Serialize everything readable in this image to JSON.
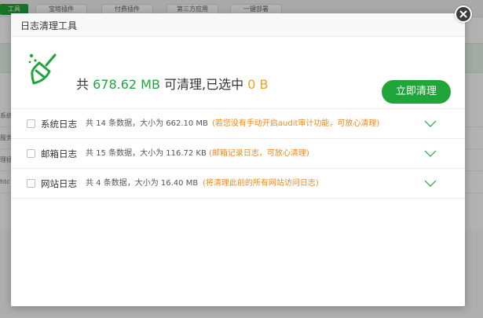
{
  "background": {
    "tabs": [
      "工具",
      "宝塔插件",
      "付费插件",
      "第三方应用",
      "一键部署"
    ],
    "row_labels": [
      "系统",
      "服务器",
      "理插",
      "htc"
    ]
  },
  "dialog": {
    "title": "日志清理工具",
    "summary": {
      "prefix": "共 ",
      "total": "678.62 MB",
      "middle": " 可清理,已选中 ",
      "selected": "0 B"
    },
    "clean_button": "立即清理",
    "rows": [
      {
        "name": "系统日志",
        "info": "共 14 条数据，大小为 662.10 MB",
        "note": "(若您没有手动开启audit审计功能，可放心清理)",
        "checked": false
      },
      {
        "name": "邮箱日志",
        "info": "共 15 条数据，大小为 116.72 KB",
        "note": "(邮箱记录日志，可放心清理)",
        "checked": false
      },
      {
        "name": "网站日志",
        "info": "共 4 条数据，大小为 16.40 MB",
        "note": "(将清理此前的所有网站访问日志)",
        "checked": false
      }
    ]
  },
  "icons": {
    "broom": "broom-icon",
    "close": "close-icon",
    "expand": "chevron-down-icon"
  },
  "colors": {
    "accent": "#20a53a",
    "warning": "#f0881a",
    "selected_value": "#f0a020"
  }
}
